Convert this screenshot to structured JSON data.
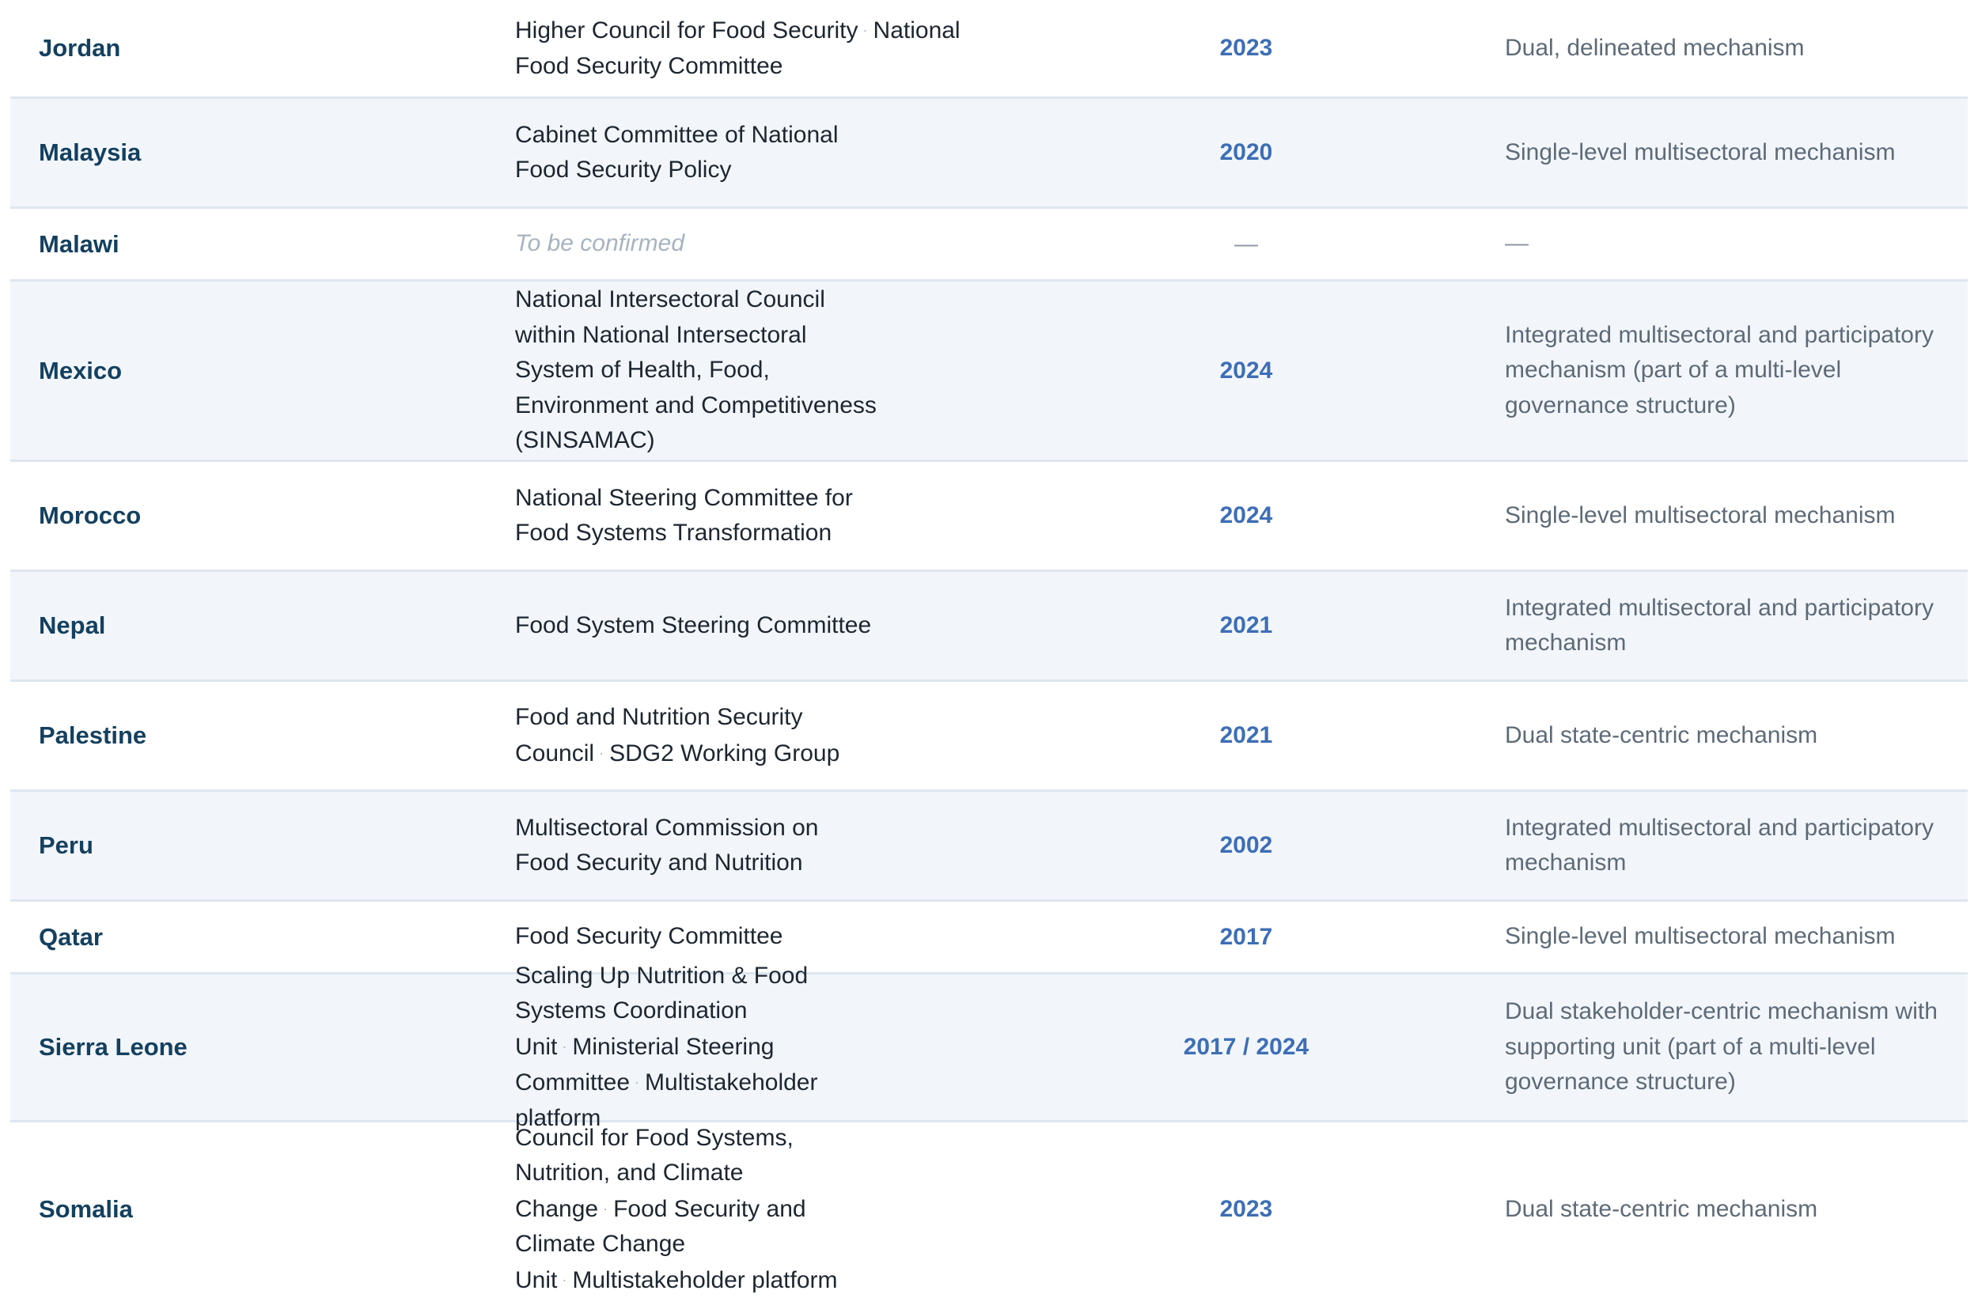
{
  "rows": [
    {
      "country": "Jordan",
      "bodies": [
        "Higher Council for Food Security",
        "National Food Security Committee"
      ],
      "year": "2023",
      "type": "Dual, delineated mechanism",
      "alt": false
    },
    {
      "country": "Malaysia",
      "bodies": [
        "Cabinet Committee of National Food Security Policy"
      ],
      "year": "2020",
      "type": "Single-level multisectoral mechanism",
      "alt": true
    },
    {
      "country": "Malawi",
      "bodies": [
        "To be confirmed"
      ],
      "tbc": true,
      "year": "—",
      "type": "—",
      "alt": false
    },
    {
      "country": "Mexico",
      "bodies": [
        "National Intersectoral Council within National Intersectoral System of Health, Food, Environment and Competitiveness (SINSAMAC)"
      ],
      "year": "2024",
      "type": "Integrated multisectoral and participatory mechanism (part of a multi-level governance structure)",
      "alt": true
    },
    {
      "country": "Morocco",
      "bodies": [
        "National Steering Committee for Food Systems Transformation"
      ],
      "year": "2024",
      "type": "Single-level multisectoral mechanism",
      "alt": false
    },
    {
      "country": "Nepal",
      "bodies": [
        "Food System Steering Committee"
      ],
      "year": "2021",
      "type": "Integrated multisectoral and participatory mechanism",
      "alt": true
    },
    {
      "country": "Palestine",
      "bodies": [
        "Food and Nutrition Security Council",
        "SDG2 Working Group"
      ],
      "year": "2021",
      "type": "Dual state-centric mechanism",
      "alt": false
    },
    {
      "country": "Peru",
      "bodies": [
        "Multisectoral Commission on Food Security and Nutrition"
      ],
      "year": "2002",
      "type": "Integrated multisectoral and participatory mechanism",
      "alt": true
    },
    {
      "country": "Qatar",
      "bodies": [
        "Food Security Committee"
      ],
      "year": "2017",
      "type": "Single-level multisectoral mechanism",
      "alt": false
    },
    {
      "country": "Sierra Leone",
      "bodies": [
        "Scaling Up Nutrition & Food Systems Coordination Unit",
        "Ministerial Steering Committee",
        "Multistakeholder platform"
      ],
      "year": "2017 / 2024",
      "type": "Dual stakeholder-centric mechanism with supporting unit (part of a multi-level governance structure)",
      "alt": true
    },
    {
      "country": "Somalia",
      "bodies": [
        "Council for Food Systems, Nutrition, and Climate Change",
        "Food Security and Climate Change Unit",
        "Multistakeholder platform"
      ],
      "year": "2023",
      "type": "Dual state-centric mechanism",
      "alt": false
    }
  ],
  "separator": "·"
}
